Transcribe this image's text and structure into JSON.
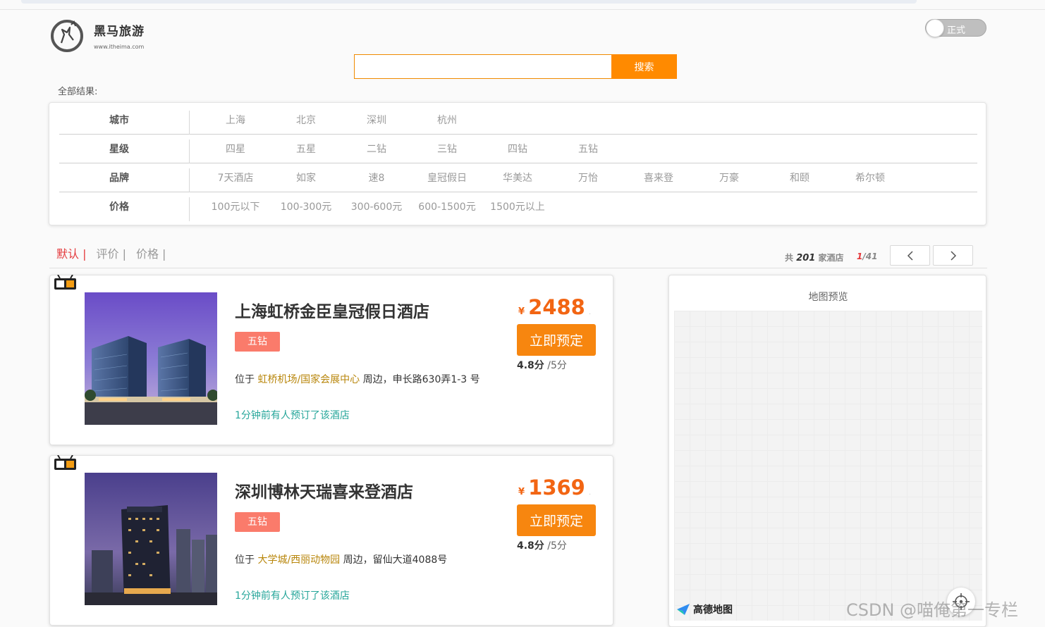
{
  "logo": {
    "name": "黑马旅游",
    "url": "www.itheima.com"
  },
  "mode_toggle": {
    "label": "正式"
  },
  "search": {
    "placeholder": "",
    "button_label": "搜索"
  },
  "results_label": "全部结果:",
  "filters": [
    {
      "label": "城市",
      "options": [
        "上海",
        "北京",
        "深圳",
        "杭州"
      ]
    },
    {
      "label": "星级",
      "options": [
        "四星",
        "五星",
        "二钻",
        "三钻",
        "四钻",
        "五钻"
      ]
    },
    {
      "label": "品牌",
      "options": [
        "7天酒店",
        "如家",
        "速8",
        "皇冠假日",
        "华美达",
        "万怡",
        "喜来登",
        "万豪",
        "和颐",
        "希尔顿"
      ]
    },
    {
      "label": "价格",
      "options": [
        "100元以下",
        "100-300元",
        "300-600元",
        "600-1500元",
        "1500元以上"
      ]
    }
  ],
  "sort": {
    "options": [
      {
        "label": "默认 |",
        "active": true
      },
      {
        "label": "评价 |",
        "active": false
      },
      {
        "label": "价格 |",
        "active": false
      }
    ]
  },
  "pager": {
    "prefix": "共",
    "total": "201",
    "suffix": "家酒店",
    "current": "1",
    "total_pages": "/41",
    "prev_icon": "chevron-left-icon",
    "next_icon": "chevron-right-icon"
  },
  "hotels": [
    {
      "name": "上海虹桥金臣皇冠假日酒店",
      "star": "五钻",
      "loc_prefix": "位于",
      "area": "虹桥机场/国家会展中心",
      "address": "周边，申长路630弄1-3 号",
      "recent": "1分钟前有人预订了该酒店",
      "currency": "¥",
      "price": "2488",
      "price_tail": ".",
      "book_label": "立即预定",
      "score": "4.8分",
      "score_max": "/5分"
    },
    {
      "name": "深圳博林天瑞喜来登酒店",
      "star": "五钻",
      "loc_prefix": "位于",
      "area": "大学城/西丽动物园",
      "address": "周边，留仙大道4088号",
      "recent": "1分钟前有人预订了该酒店",
      "currency": "¥",
      "price": "1369",
      "price_tail": ".",
      "book_label": "立即预定",
      "score": "4.8分",
      "score_max": "/5分"
    }
  ],
  "map": {
    "title": "地图预览",
    "provider": "高德地图"
  },
  "watermark": "CSDN @喵俺第一专栏",
  "colors": {
    "accent": "#ff8a00",
    "star_badge": "#fa7b6b",
    "price": "#f26513",
    "active_sort": "#e4393c",
    "recent_text": "#26a69a",
    "area_text": "#b8860b"
  }
}
